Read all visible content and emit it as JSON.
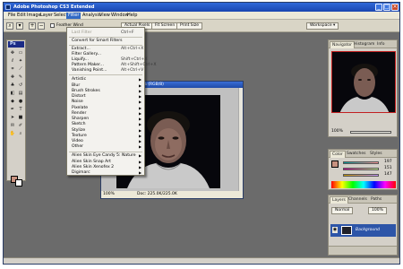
{
  "app": {
    "title": "Adobe Photoshop CS3 Extended"
  },
  "menubar": [
    "File",
    "Edit",
    "Image",
    "Layer",
    "Select",
    "Filter",
    "Analysis",
    "View",
    "Window",
    "Help"
  ],
  "options": {
    "fade_label": "Feather Wind",
    "buttons": [
      "Actual Pixels",
      "Fit Screen",
      "Print Size"
    ],
    "workspace": "Workspace ▾"
  },
  "filter_menu": {
    "last_filter": {
      "label": "Last Filter",
      "shortcut": "Ctrl+F"
    },
    "convert": "Convert for Smart Filters",
    "group1": [
      {
        "label": "Extract...",
        "shortcut": "Alt+Ctrl+X"
      },
      {
        "label": "Filter Gallery...",
        "shortcut": ""
      },
      {
        "label": "Liquify...",
        "shortcut": "Shift+Ctrl+X"
      },
      {
        "label": "Pattern Maker...",
        "shortcut": "Alt+Shift+Ctrl+X"
      },
      {
        "label": "Vanishing Point...",
        "shortcut": "Alt+Ctrl+V"
      }
    ],
    "group2": [
      "Artistic",
      "Blur",
      "Brush Strokes",
      "Distort",
      "Noise",
      "Pixelate",
      "Render",
      "Sharpen",
      "Sketch",
      "Stylize",
      "Texture",
      "Video",
      "Other"
    ],
    "group3": [
      "Alien Skin Eye Candy 5: Nature",
      "Alien Skin Snap Art",
      "Alien Skin Xenofex 2",
      "Digimarc"
    ]
  },
  "document": {
    "title": "100% (RGB/8)",
    "zoom": "100%",
    "doc_size": "Doc: 225.0K/225.0K"
  },
  "navigator": {
    "tabs": [
      "Navigator",
      "Histogram",
      "Info"
    ],
    "zoom": "100%"
  },
  "color_panel": {
    "tabs": [
      "Color",
      "Swatches",
      "Styles"
    ],
    "r": "197",
    "g": "151",
    "b": "147",
    "foreground": "#c89280"
  },
  "layers_panel": {
    "tabs": [
      "Layers",
      "Channels",
      "Paths"
    ],
    "blend": "Normal",
    "opacity": "100%",
    "layer_name": "Background"
  },
  "toolbox": {
    "logo": "Ps",
    "foreground": "#c89280",
    "background": "#ffffff"
  },
  "colors": {
    "titlebar": "#1a46b0",
    "workspace": "#6b6b6b",
    "menu_bg": "#f3f2ee",
    "selection": "#2d55a8"
  }
}
